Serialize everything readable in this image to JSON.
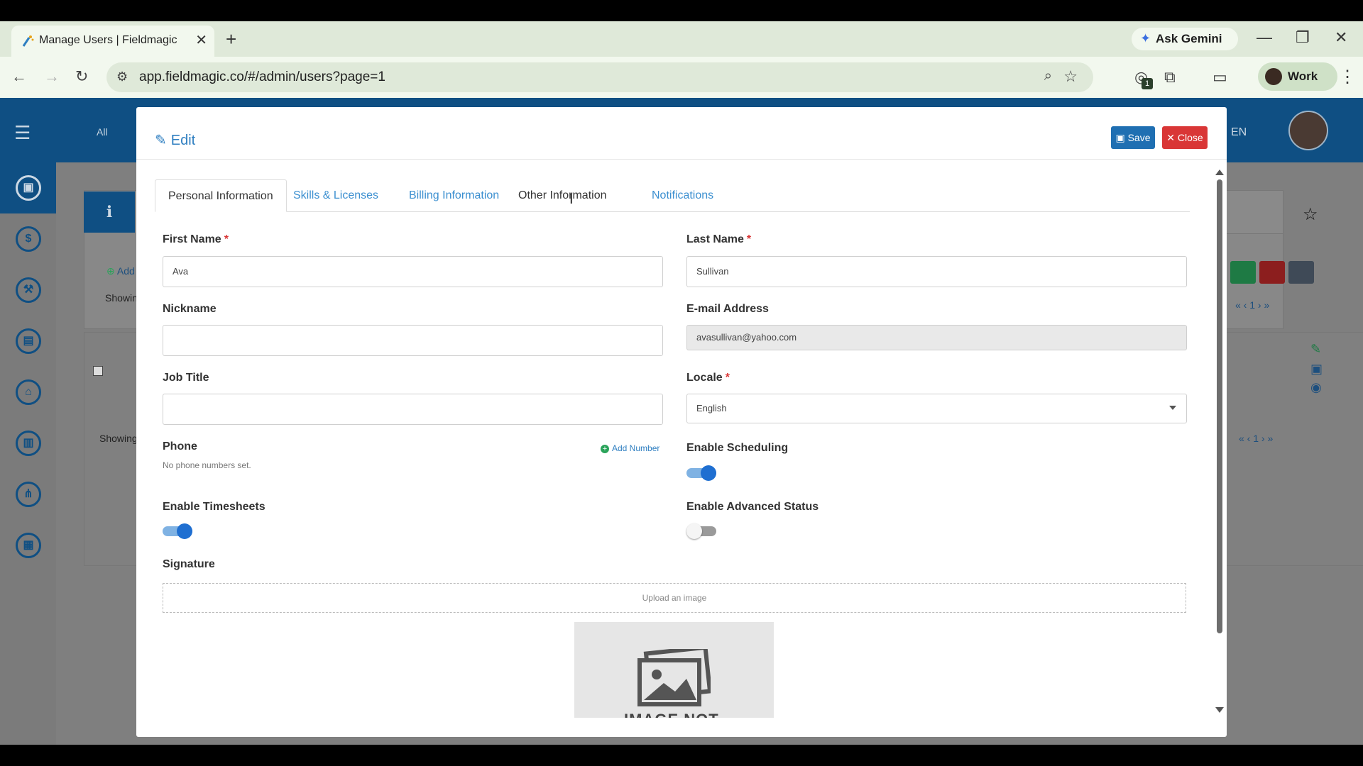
{
  "browser": {
    "tab_title": "Manage Users | Fieldmagic",
    "ask_gemini": "Ask Gemini",
    "url": "app.fieldmagic.co/#/admin/users?page=1",
    "profile": "Work",
    "extension_badge": "1"
  },
  "app": {
    "filter_all": "All",
    "language": "EN",
    "add_link": "Add",
    "showing_top": "Showin",
    "showing_bottom": "Showing",
    "page_top": "1",
    "page_bottom": "1"
  },
  "modal": {
    "title": "Edit",
    "save_label": "Save",
    "close_label": "Close",
    "tabs": [
      {
        "label": "Personal Information"
      },
      {
        "label": "Skills & Licenses"
      },
      {
        "label": "Billing Information"
      },
      {
        "label": "Other Information"
      },
      {
        "label": "Notifications"
      }
    ],
    "fields": {
      "first_name": {
        "label": "First Name",
        "value": "Ava",
        "required": "*"
      },
      "last_name": {
        "label": "Last Name",
        "value": "Sullivan",
        "required": "*"
      },
      "nickname": {
        "label": "Nickname",
        "value": ""
      },
      "email": {
        "label": "E-mail Address",
        "value": "avasullivan@yahoo.com"
      },
      "job_title": {
        "label": "Job Title",
        "value": ""
      },
      "locale": {
        "label": "Locale",
        "value": "English",
        "required": "*"
      },
      "phone": {
        "label": "Phone",
        "add_label": "Add Number",
        "empty_text": "No phone numbers set."
      },
      "enable_scheduling": {
        "label": "Enable Scheduling",
        "on": true
      },
      "enable_timesheets": {
        "label": "Enable Timesheets",
        "on": true
      },
      "enable_advanced_status": {
        "label": "Enable Advanced Status",
        "on": false
      },
      "signature": {
        "label": "Signature",
        "upload_text": "Upload an image",
        "placeholder_caption": "IMAGE NOT"
      }
    }
  },
  "colors": {
    "primary": "#1f6fb2",
    "danger": "#d93636",
    "link": "#3b8fd0",
    "header": "#0f4f83",
    "success": "#2aa35a"
  }
}
